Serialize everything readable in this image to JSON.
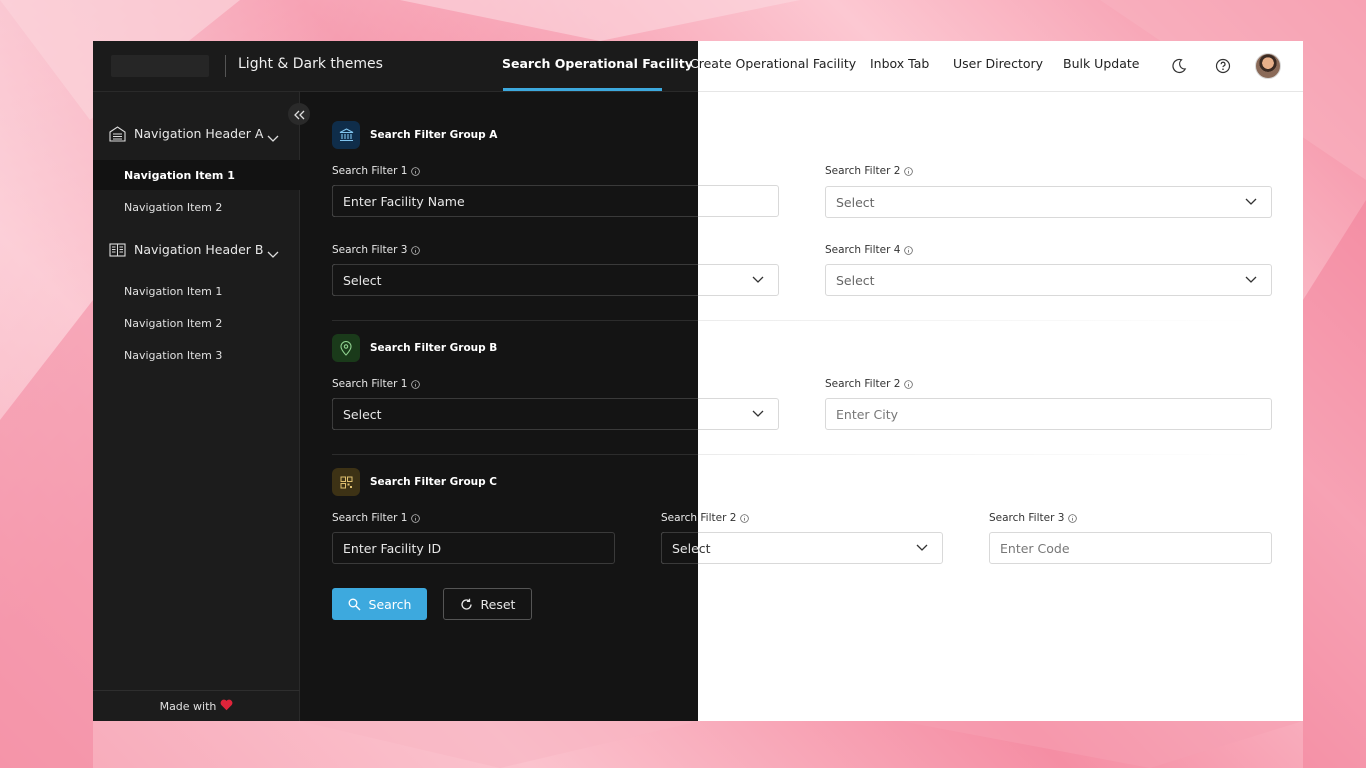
{
  "app": {
    "title": "Light & Dark themes"
  },
  "tabs": [
    {
      "label": "Search Operational Facility",
      "active": true
    },
    {
      "label": "Create Operational Facility",
      "active": false
    },
    {
      "label": "Inbox Tab",
      "active": false
    },
    {
      "label": "User Directory",
      "active": false
    },
    {
      "label": "Bulk Update",
      "active": false
    }
  ],
  "header_icons": [
    "moon-icon",
    "help-icon",
    "avatar"
  ],
  "sidebar": {
    "groups": [
      {
        "header": "Navigation Header A",
        "icon": "building-icon",
        "items": [
          {
            "label": "Navigation Item 1",
            "active": true
          },
          {
            "label": "Navigation Item 2",
            "active": false
          }
        ]
      },
      {
        "header": "Navigation Header B",
        "icon": "book-icon",
        "items": [
          {
            "label": "Navigation Item 1",
            "active": false
          },
          {
            "label": "Navigation Item 2",
            "active": false
          },
          {
            "label": "Navigation Item 3",
            "active": false
          }
        ]
      }
    ],
    "footer": "Made with",
    "footer_icon": "heart-icon"
  },
  "groups": {
    "a": {
      "title": "Search Filter Group A",
      "icon": "bank-icon",
      "filter1": {
        "label": "Search Filter 1",
        "placeholder": "Enter Facility Name"
      },
      "filter2": {
        "label": "Search Filter 2",
        "placeholder": "Select"
      },
      "filter3": {
        "label": "Search Filter 3",
        "placeholder": "Select"
      },
      "filter4": {
        "label": "Search Filter 4",
        "placeholder": "Select"
      }
    },
    "b": {
      "title": "Search Filter Group B",
      "icon": "location-pin-icon",
      "filter1": {
        "label": "Search Filter 1",
        "placeholder": "Select"
      },
      "filter2": {
        "label": "Search Filter 2",
        "placeholder": "Enter City"
      }
    },
    "c": {
      "title": "Search Filter Group C",
      "icon": "qr-code-icon",
      "filter1": {
        "label": "Search Filter 1",
        "placeholder": "Enter Facility ID"
      },
      "filter2": {
        "label": "Search Filter 2",
        "placeholder": "Select"
      },
      "filter3": {
        "label": "Search Filter 3",
        "placeholder": "Enter Code"
      }
    }
  },
  "actions": {
    "search": "Search",
    "reset": "Reset"
  },
  "colors": {
    "accent": "#3da9de",
    "dark_bg": "#141414",
    "group_a_icon_bg": "#0f2d4a",
    "group_b_icon_bg": "#1a3a1a",
    "group_c_icon_bg": "#3d3215"
  }
}
